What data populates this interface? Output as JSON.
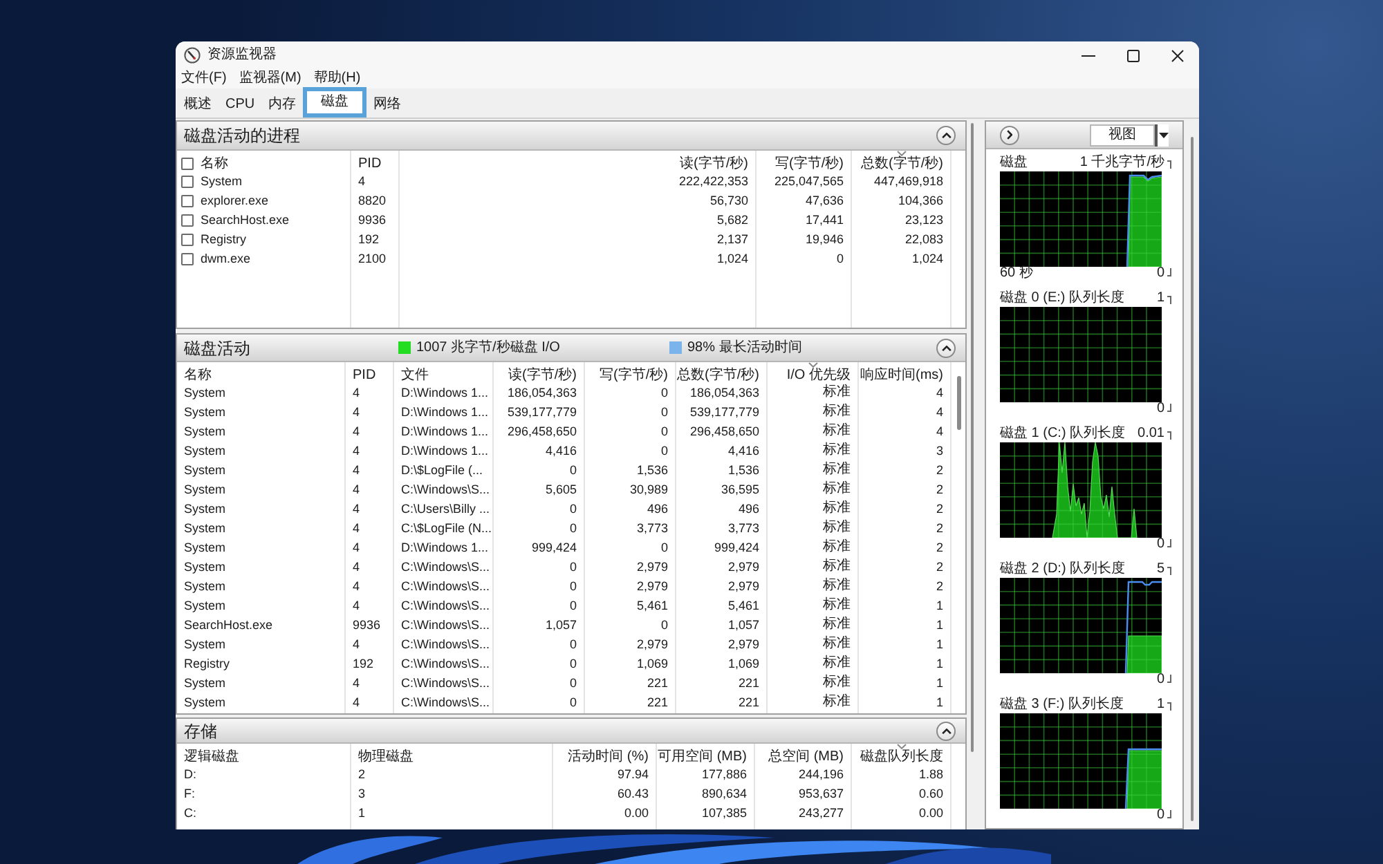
{
  "window": {
    "title": "资源监视器"
  },
  "menu": [
    "文件(F)",
    "监视器(M)",
    "帮助(H)"
  ],
  "tabs": [
    {
      "label": "概述",
      "selected": false
    },
    {
      "label": "CPU",
      "selected": false
    },
    {
      "label": "内存",
      "selected": false
    },
    {
      "label": "磁盘",
      "selected": true
    },
    {
      "label": "网络",
      "selected": false
    }
  ],
  "processes": {
    "title": "磁盘活动的进程",
    "header_checkbox": {
      "checked": false
    },
    "columns": [
      {
        "label": "名称",
        "sorted": false
      },
      {
        "label": "PID",
        "sorted": false
      },
      {
        "label": "读(字节/秒)",
        "sorted": false
      },
      {
        "label": "写(字节/秒)",
        "sorted": false
      },
      {
        "label": "总数(字节/秒)",
        "sorted": true
      }
    ],
    "rows": [
      {
        "checked": false,
        "cells": [
          "System",
          "4",
          "222,422,353",
          "225,047,565",
          "447,469,918"
        ]
      },
      {
        "checked": false,
        "cells": [
          "explorer.exe",
          "8820",
          "56,730",
          "47,636",
          "104,366"
        ]
      },
      {
        "checked": false,
        "cells": [
          "SearchHost.exe",
          "9936",
          "5,682",
          "17,441",
          "23,123"
        ]
      },
      {
        "checked": false,
        "cells": [
          "Registry",
          "192",
          "2,137",
          "19,946",
          "22,083"
        ]
      },
      {
        "checked": false,
        "cells": [
          "dwm.exe",
          "2100",
          "1,024",
          "0",
          "1,024"
        ]
      }
    ]
  },
  "disk_activity": {
    "title": "磁盘活动",
    "legend": [
      {
        "text": "1007 兆字节/秒磁盘 I/O",
        "color": "#22dd22"
      },
      {
        "text": "98% 最长活动时间",
        "color": "#7ab4ea"
      }
    ],
    "columns": [
      {
        "label": "名称",
        "sorted": false
      },
      {
        "label": "PID",
        "sorted": false
      },
      {
        "label": "文件",
        "sorted": false
      },
      {
        "label": "读(字节/秒)",
        "sorted": false
      },
      {
        "label": "写(字节/秒)",
        "sorted": false
      },
      {
        "label": "总数(字节/秒)",
        "sorted": false
      },
      {
        "label": "I/O 优先级",
        "sorted": true
      },
      {
        "label": "响应时间(ms)",
        "sorted": false
      }
    ],
    "rows": [
      [
        "System",
        "4",
        "D:\\Windows 1...",
        "186,054,363",
        "0",
        "186,054,363",
        "标准",
        "4"
      ],
      [
        "System",
        "4",
        "D:\\Windows 1...",
        "539,177,779",
        "0",
        "539,177,779",
        "标准",
        "4"
      ],
      [
        "System",
        "4",
        "D:\\Windows 1...",
        "296,458,650",
        "0",
        "296,458,650",
        "标准",
        "4"
      ],
      [
        "System",
        "4",
        "D:\\Windows 1...",
        "4,416",
        "0",
        "4,416",
        "标准",
        "3"
      ],
      [
        "System",
        "4",
        "D:\\$LogFile (...",
        "0",
        "1,536",
        "1,536",
        "标准",
        "2"
      ],
      [
        "System",
        "4",
        "C:\\Windows\\S...",
        "5,605",
        "30,989",
        "36,595",
        "标准",
        "2"
      ],
      [
        "System",
        "4",
        "C:\\Users\\Billy ...",
        "0",
        "496",
        "496",
        "标准",
        "2"
      ],
      [
        "System",
        "4",
        "C:\\$LogFile (N...",
        "0",
        "3,773",
        "3,773",
        "标准",
        "2"
      ],
      [
        "System",
        "4",
        "D:\\Windows 1...",
        "999,424",
        "0",
        "999,424",
        "标准",
        "2"
      ],
      [
        "System",
        "4",
        "C:\\Windows\\S...",
        "0",
        "2,979",
        "2,979",
        "标准",
        "2"
      ],
      [
        "System",
        "4",
        "C:\\Windows\\S...",
        "0",
        "2,979",
        "2,979",
        "标准",
        "2"
      ],
      [
        "System",
        "4",
        "C:\\Windows\\S...",
        "0",
        "5,461",
        "5,461",
        "标准",
        "1"
      ],
      [
        "SearchHost.exe",
        "9936",
        "C:\\Windows\\S...",
        "1,057",
        "0",
        "1,057",
        "标准",
        "1"
      ],
      [
        "System",
        "4",
        "C:\\Windows\\S...",
        "0",
        "2,979",
        "2,979",
        "标准",
        "1"
      ],
      [
        "Registry",
        "192",
        "C:\\Windows\\S...",
        "0",
        "1,069",
        "1,069",
        "标准",
        "1"
      ],
      [
        "System",
        "4",
        "C:\\Windows\\S...",
        "0",
        "221",
        "221",
        "标准",
        "1"
      ],
      [
        "System",
        "4",
        "C:\\Windows\\S...",
        "0",
        "221",
        "221",
        "标准",
        "1"
      ]
    ]
  },
  "storage": {
    "title": "存储",
    "columns": [
      {
        "label": "逻辑磁盘",
        "sorted": false
      },
      {
        "label": "物理磁盘",
        "sorted": false
      },
      {
        "label": "活动时间 (%)",
        "sorted": false
      },
      {
        "label": "可用空间 (MB)",
        "sorted": false
      },
      {
        "label": "总空间 (MB)",
        "sorted": false
      },
      {
        "label": "磁盘队列长度",
        "sorted": true
      }
    ],
    "rows": [
      [
        "D:",
        "2",
        "97.94",
        "177,886",
        "244,196",
        "1.88"
      ],
      [
        "F:",
        "3",
        "60.43",
        "890,634",
        "953,637",
        "0.60"
      ],
      [
        "C:",
        "1",
        "0.00",
        "107,385",
        "243,277",
        "0.00"
      ]
    ]
  },
  "graph_pane": {
    "view_button": "视图",
    "graphs": [
      {
        "title": "磁盘",
        "scale_max": "1 千兆字节/秒",
        "time_span": "60 秒",
        "scale_min": "0"
      },
      {
        "title": "磁盘 0 (E:) 队列长度",
        "scale_max": "1",
        "scale_min": "0"
      },
      {
        "title": "磁盘 1 (C:) 队列长度",
        "scale_max": "0.01",
        "scale_min": "0"
      },
      {
        "title": "磁盘 2 (D:) 队列长度",
        "scale_max": "5",
        "scale_min": "0"
      },
      {
        "title": "磁盘 3 (F:) 队列长度",
        "scale_max": "1",
        "scale_min": "0"
      }
    ]
  }
}
